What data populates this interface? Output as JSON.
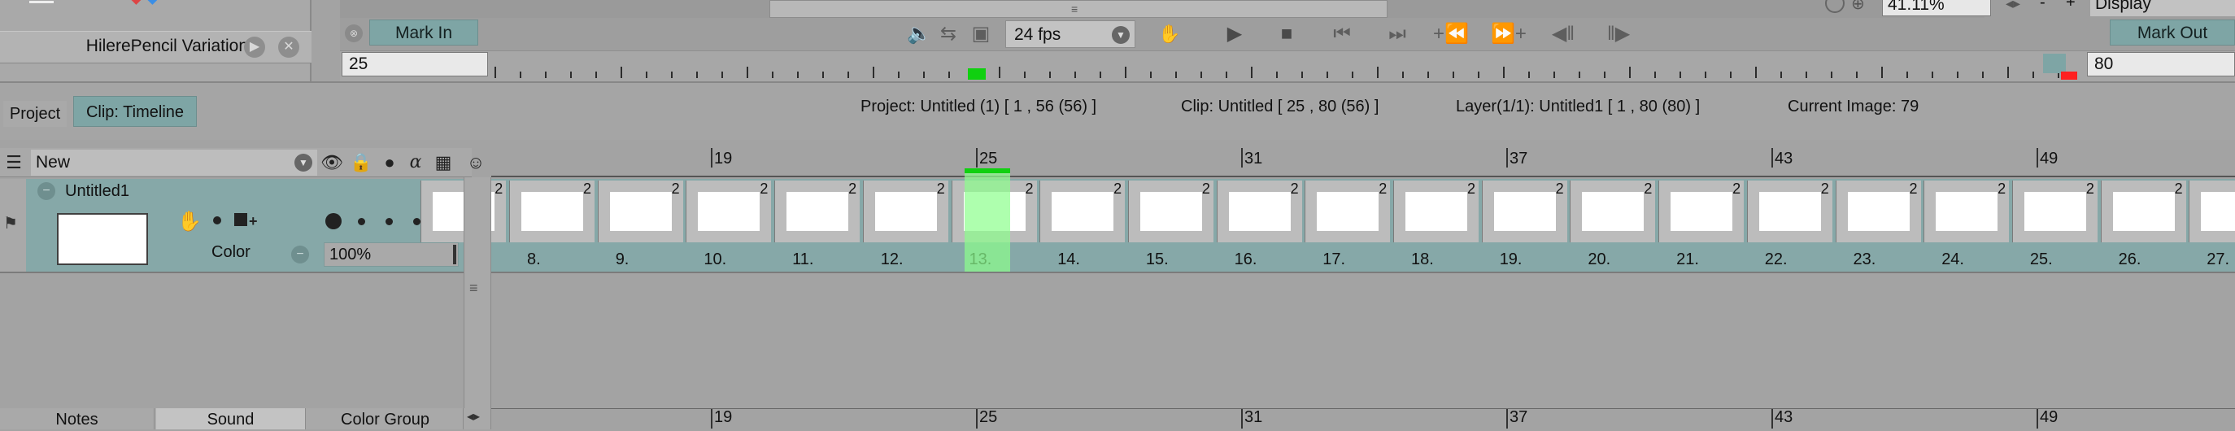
{
  "palette": {
    "pencil_name": "HilerePencil Variation"
  },
  "transport": {
    "mark_in_label": "Mark In",
    "mark_out_label": "Mark Out",
    "mark_in_value": "25",
    "mark_out_value": "80",
    "fps": "24 fps",
    "zoom": "41.11%",
    "display_label": "Display",
    "zoom_minus": "-",
    "zoom_plus": "+"
  },
  "tabs": {
    "project": "Project",
    "clip_timeline": "Clip: Timeline"
  },
  "info": {
    "project": "Project: Untitled (1) [ 1 , 56  (56) ]",
    "clip": "Clip: Untitled [ 25 , 80  (56) ]",
    "layer": "Layer(1/1): Untitled1 [ 1 , 80  (80) ]",
    "current_image": "Current Image: 79"
  },
  "layer_header": {
    "new_label": "New"
  },
  "layer": {
    "name": "Untitled1",
    "color_label": "Color",
    "opacity": "100%"
  },
  "frame_ruler": {
    "labels": [
      {
        "value": "19",
        "offset": 0
      },
      {
        "value": "25",
        "offset": 1
      },
      {
        "value": "31",
        "offset": 2
      },
      {
        "value": "37",
        "offset": 3
      },
      {
        "value": "43",
        "offset": 4
      },
      {
        "value": "49",
        "offset": 5
      }
    ]
  },
  "track": {
    "cell_exposure": "2",
    "frame_labels": [
      "8.",
      "9.",
      "10.",
      "11.",
      "12.",
      "13.",
      "14.",
      "15.",
      "16.",
      "17.",
      "18.",
      "19.",
      "20.",
      "21.",
      "22.",
      "23.",
      "24.",
      "25.",
      "26.",
      "27."
    ],
    "selected_label": "13."
  },
  "bottom_tabs": {
    "notes": "Notes",
    "sound": "Sound",
    "color_group": "Color Group"
  },
  "colors": {
    "accent_teal": "#7ea5a5",
    "selection_green": "#8cff8c",
    "mark_red": "#ff2020"
  }
}
